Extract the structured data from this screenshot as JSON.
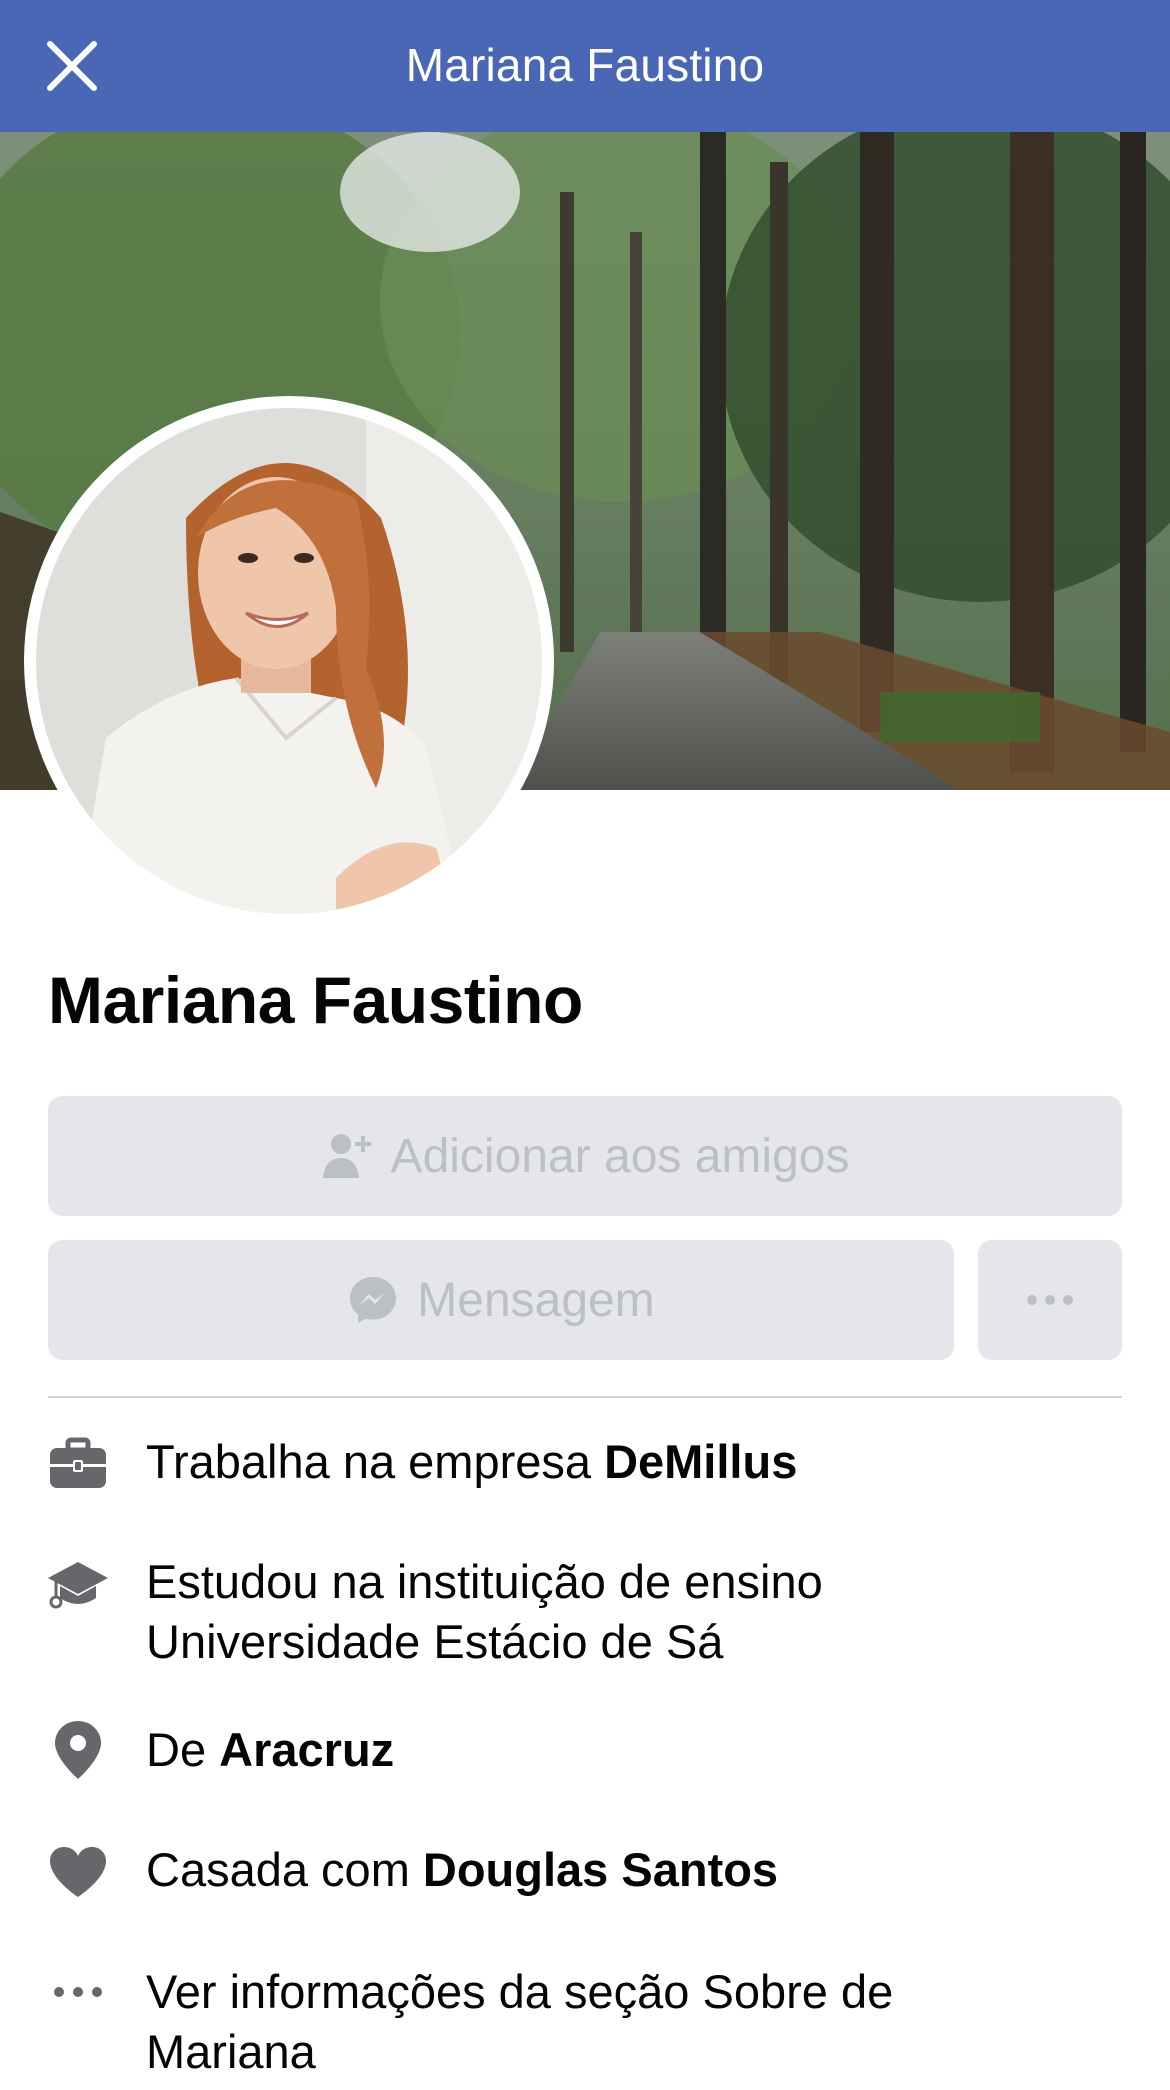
{
  "header": {
    "title": "Mariana Faustino",
    "close_icon": "close-icon"
  },
  "profile": {
    "name": "Mariana Faustino",
    "cover_photo": "cover-photo-forest-road",
    "avatar": "profile-photo"
  },
  "actions": {
    "add_friend_label": "Adicionar aos amigos",
    "add_friend_icon": "add-friend-icon",
    "message_label": "Mensagem",
    "message_icon": "messenger-icon",
    "more_icon": "more-icon"
  },
  "info": {
    "work": {
      "prefix": "Trabalha na empresa ",
      "value": "DeMillus",
      "icon": "briefcase-icon"
    },
    "education": {
      "line1": "Estudou na instituição de ensino",
      "line2": "Universidade Estácio de Sá",
      "icon": "graduation-cap-icon"
    },
    "hometown": {
      "prefix": "De ",
      "value": "Aracruz",
      "icon": "location-pin-icon"
    },
    "relationship": {
      "prefix": "Casada com ",
      "value": "Douglas Santos",
      "icon": "heart-icon"
    },
    "about": {
      "line1": "Ver informações da seção Sobre de",
      "line2": "Mariana",
      "icon": "more-dots-icon"
    }
  },
  "colors": {
    "header_bg": "#4a67b5",
    "button_bg": "#e4e6eb",
    "button_text_disabled": "#bcc0c4",
    "icon_gray": "#65676b"
  }
}
